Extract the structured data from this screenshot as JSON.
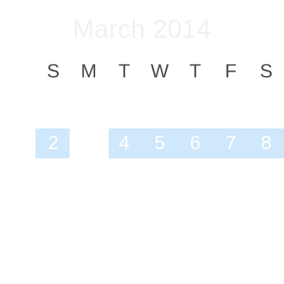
{
  "calendar": {
    "month_title": "March 2014",
    "weekdays": [
      "S",
      "M",
      "T",
      "W",
      "T",
      "F",
      "S"
    ],
    "week": {
      "days": [
        "2",
        "4",
        "5",
        "6",
        "7",
        "8"
      ]
    }
  },
  "colors": {
    "highlight": "#cfe8fb",
    "weekday_text": "#4a4a4a",
    "title_text": "#f1f1f1",
    "day_text": "#ffffff"
  }
}
